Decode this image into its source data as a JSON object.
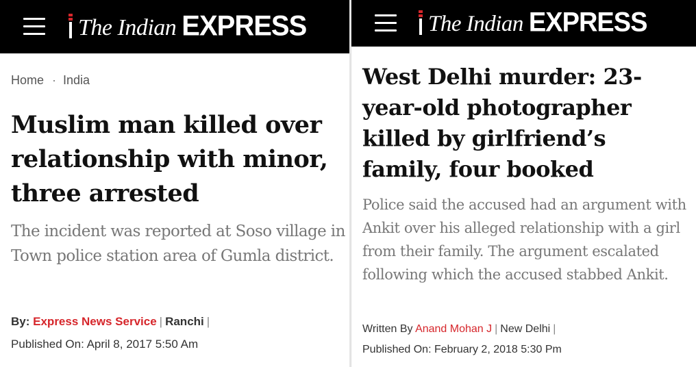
{
  "left": {
    "brand": {
      "serif": "The Indian",
      "sans": "EXPRESS"
    },
    "breadcrumb": {
      "home": "Home",
      "sep": "·",
      "section": "India"
    },
    "headline": "Muslim man killed over relationship with minor, three arrested",
    "summary": "The incident was reported at Soso village in Town police station area of Gumla district.",
    "byline": {
      "label": "By:",
      "author": "Express News Service",
      "pipe": "|",
      "place": "Ranchi",
      "pipe2": "|"
    },
    "published": "Published On: April 8, 2017 5:50 Am"
  },
  "right": {
    "brand": {
      "serif": "The Indian",
      "sans": "EXPRESS"
    },
    "headline": "West Delhi murder: 23-year-old photographer killed by girlfriend’s family, four booked",
    "summary": "Police said the accused had an argument with Ankit over his alleged relationship with a girl from their family. The argument escalated following which the accused stabbed Ankit.",
    "byline": {
      "label": "Written By",
      "author": "Anand Mohan J",
      "pipe": "|",
      "place": "New Delhi",
      "pipe2": "|"
    },
    "published": "Published On: February 2, 2018 5:30 Pm"
  },
  "colors": {
    "brand_red": "#d6262b",
    "topbar": "#000000",
    "summary_gray": "#777777"
  }
}
